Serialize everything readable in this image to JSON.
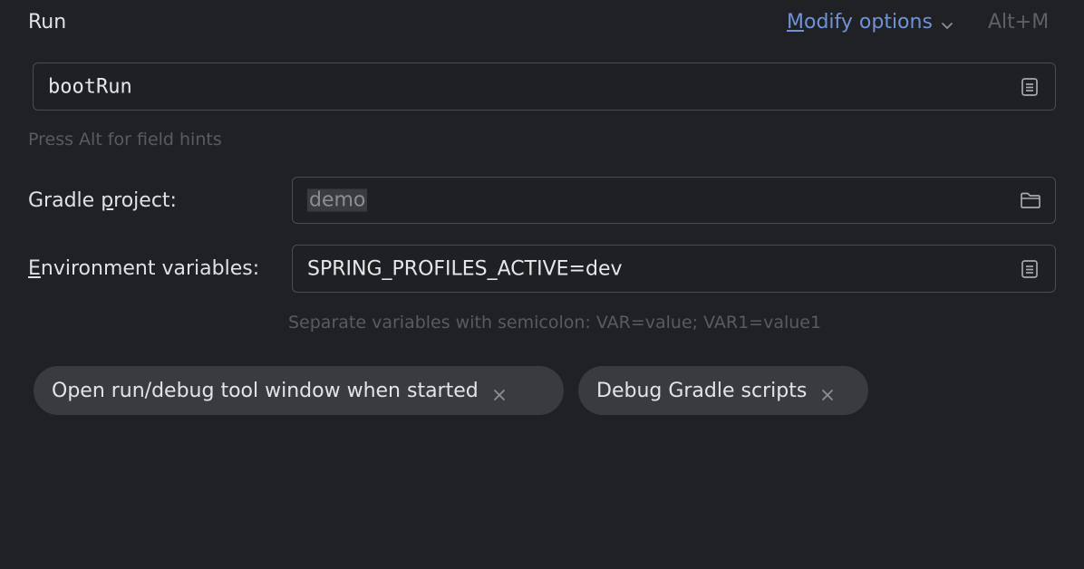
{
  "header": {
    "title": "Run",
    "modify_options_prefix": "M",
    "modify_options_rest": "odify options",
    "shortcut": "Alt+M"
  },
  "task": {
    "value": "bootRun",
    "hint": "Press Alt for field hints"
  },
  "gradle_project": {
    "label_prefix": "Gradle ",
    "label_mnemonic": "p",
    "label_rest": "roject:",
    "value": "demo"
  },
  "env": {
    "label_mnemonic": "E",
    "label_rest": "nvironment variables:",
    "value": "SPRING_PROFILES_ACTIVE=dev",
    "hint": "Separate variables with semicolon: VAR=value; VAR1=value1"
  },
  "chips": [
    {
      "label": "Open run/debug tool window when started"
    },
    {
      "label": "Debug Gradle scripts"
    }
  ],
  "colors": {
    "background": "#202124",
    "link": "#6f93d6",
    "field_border": "#4a4c50",
    "chip_bg": "#393b40"
  },
  "icons": {
    "expand": "expand-text-icon",
    "folder": "folder-icon",
    "chevron": "chevron-down-icon",
    "remove": "close-icon"
  }
}
